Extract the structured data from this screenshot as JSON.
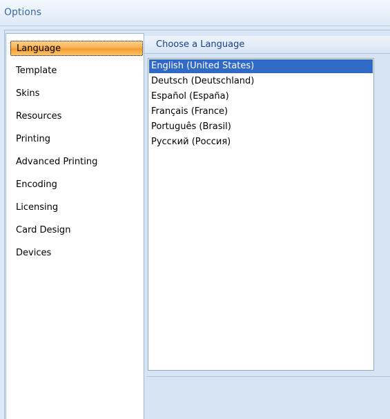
{
  "window": {
    "title": "Options"
  },
  "nav": {
    "items": [
      {
        "label": "Language",
        "selected": true
      },
      {
        "label": "Template",
        "selected": false
      },
      {
        "label": "Skins",
        "selected": false
      },
      {
        "label": "Resources",
        "selected": false
      },
      {
        "label": "Printing",
        "selected": false
      },
      {
        "label": "Advanced Printing",
        "selected": false
      },
      {
        "label": "Encoding",
        "selected": false
      },
      {
        "label": "Licensing",
        "selected": false
      },
      {
        "label": "Card Design",
        "selected": false
      },
      {
        "label": "Devices",
        "selected": false
      }
    ]
  },
  "language_panel": {
    "header": "Choose a Language",
    "languages": [
      {
        "label": "English (United States)",
        "selected": true
      },
      {
        "label": "Deutsch (Deutschland)",
        "selected": false
      },
      {
        "label": "Español (España)",
        "selected": false
      },
      {
        "label": "Français (France)",
        "selected": false
      },
      {
        "label": "Português (Brasil)",
        "selected": false
      },
      {
        "label": "Русский (Россия)",
        "selected": false
      }
    ]
  },
  "colors": {
    "selection_orange": "#f8b35a",
    "list_selection_blue": "#3169c6",
    "title_blue": "#3b6aa8"
  }
}
